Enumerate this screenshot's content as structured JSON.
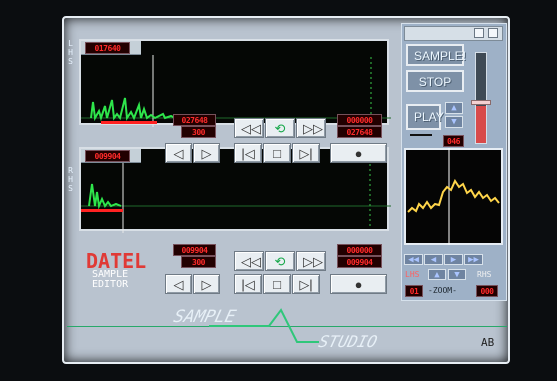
{
  "titlebar": {
    "left": "SAMPLE",
    "center": "STUDIO",
    "right": "AB"
  },
  "left_channel": {
    "label": "LHS",
    "top_value": "017640",
    "display_a": "027648",
    "display_b": "300",
    "display_c": "000000",
    "display_d": "027648"
  },
  "right_channel": {
    "label": "RHS",
    "top_value": "009904",
    "display_a": "009904",
    "display_b": "300",
    "display_c": "000000",
    "display_d": "009904"
  },
  "controls": {
    "rewind": "◁◁",
    "loop": "⟲",
    "forward": "▷▷",
    "prev": "◁",
    "play": "▷",
    "start": "|◁",
    "stop": "□",
    "end": "▷|",
    "record": "●"
  },
  "side_panel": {
    "sample_button": "SAMPLE!",
    "stop_button": "STOP",
    "play_button": "PLAY",
    "volume_value": "046",
    "lhs": "LHS",
    "rhs": "RHS",
    "zoom": "-ZOOM-",
    "zoom_left": "01",
    "zoom_right": "000"
  },
  "branding": {
    "company": "DATEL",
    "product_line1": "SAMPLE",
    "product_line2": "EDITOR"
  }
}
